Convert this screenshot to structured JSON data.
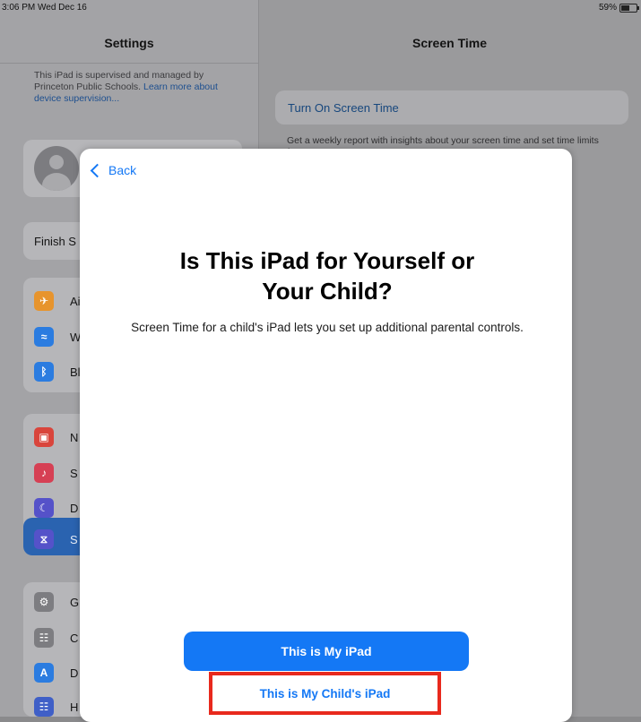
{
  "status_bar": {
    "time": "3:06 PM  Wed Dec 16",
    "battery": "59%"
  },
  "left_panel": {
    "title": "Settings",
    "supervision_text": "This iPad is supervised and managed by Princeton Public Schools.",
    "supervision_link": "Learn more about device supervision...",
    "finish_label": "Finish S",
    "groups": [
      {
        "items": [
          {
            "icon": "airplane-icon",
            "label": "Ai",
            "color": "#e7942d"
          },
          {
            "icon": "wifi-icon",
            "label": "W",
            "color": "#2b7ce0"
          },
          {
            "icon": "bluetooth-icon",
            "label": "Bl",
            "color": "#2b7ce0"
          }
        ]
      },
      {
        "items": [
          {
            "icon": "notifications-icon",
            "label": "N",
            "color": "#d9453c"
          },
          {
            "icon": "sounds-icon",
            "label": "S",
            "color": "#d64054"
          },
          {
            "icon": "moon-icon",
            "label": "D",
            "color": "#5552c9"
          },
          {
            "icon": "hourglass-icon",
            "label": "S",
            "color": "#5552c9"
          }
        ]
      },
      {
        "items": [
          {
            "icon": "gear-icon",
            "label": "G",
            "color": "#7d7d81"
          },
          {
            "icon": "control-center-icon",
            "label": "C",
            "color": "#7d7d81"
          },
          {
            "icon": "display-icon",
            "label": "D",
            "color": "#2b7ce0"
          },
          {
            "icon": "home-screen-icon",
            "label": "H",
            "color": "#3f5fc7"
          }
        ]
      }
    ]
  },
  "right_panel": {
    "title": "Screen Time",
    "turn_on_label": "Turn On Screen Time",
    "report_text": "Get a weekly report with insights about your screen time and set time limits for apps you want to manage."
  },
  "modal": {
    "back_label": "Back",
    "title": "Is This iPad for Yourself or Your Child?",
    "subtitle": "Screen Time for a child's iPad lets you set up additional parental controls.",
    "primary_button": "This is My iPad",
    "secondary_button": "This is My Child's iPad"
  },
  "colors": {
    "accent": "#1478f5",
    "highlight": "#e8291d"
  }
}
